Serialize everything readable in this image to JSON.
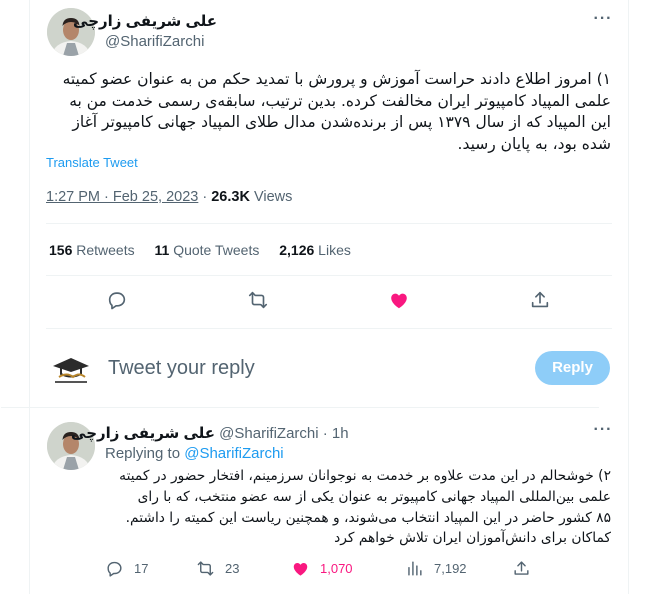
{
  "main_tweet": {
    "display_name": "علی شریفی زارچی",
    "handle": "@SharifiZarchi",
    "text_lines": [
      "۱) امروز اطلاع دادند حراست آموزش و پرورش با تمدید حکم من به عنوان عضو کمیته",
      "علمی المپیاد کامپیوتر ایران مخالفت کرده. بدین ترتیب، سابقه‌ی رسمی خدمت من به",
      "این المپیاد که از سال ۱۳۷۹ پس از برنده‌شدن مدال طلای المپیاد جهانی کامپیوتر آغاز",
      "شده بود، به پایان رسید."
    ],
    "translate_label": "Translate Tweet",
    "time": "1:27 PM · Feb 25, 2023",
    "views_count": "26.3K",
    "views_label": "Views",
    "stats": {
      "retweets_count": "156",
      "retweets_label": "Retweets",
      "quotes_count": "11",
      "quotes_label": "Quote Tweets",
      "likes_count": "2,126",
      "likes_label": "Likes"
    },
    "icons": [
      "reply-icon",
      "retweet-icon",
      "like-icon-filled",
      "share-icon"
    ],
    "like_color": "#f91880"
  },
  "composer": {
    "placeholder": "Tweet your reply",
    "reply_button": "Reply",
    "reply_button_color": "#8ecdf8"
  },
  "reply_tweet": {
    "display_name": "علی شریفی زارچی",
    "handle": "@SharifiZarchi",
    "age": "· 1h",
    "replying_to_label": "Replying to",
    "replying_to_handle": "@SharifiZarchi",
    "text_lines": [
      "۲) خوشحالم در این مدت علاوه بر خدمت به نوجوانان سرزمینم، افتخار حضور در کمیته",
      "علمی بین‌المللی المپیاد جهانی کامپیوتر به عنوان یکی از سه عضو منتخب، که با رای",
      "۸۵ کشور حاضر در این المپیاد انتخاب می‌شوند، و همچنین ریاست این کمیته را داشتم.",
      "کماکان برای دانش‌آموزان ایران تلاش خواهم کرد"
    ],
    "actions": {
      "replies": "17",
      "retweets": "23",
      "likes": "1,070",
      "views": "7,192"
    }
  },
  "colors": {
    "accent": "#1d9bf0",
    "secondary_text": "#536471",
    "like": "#f91880"
  }
}
